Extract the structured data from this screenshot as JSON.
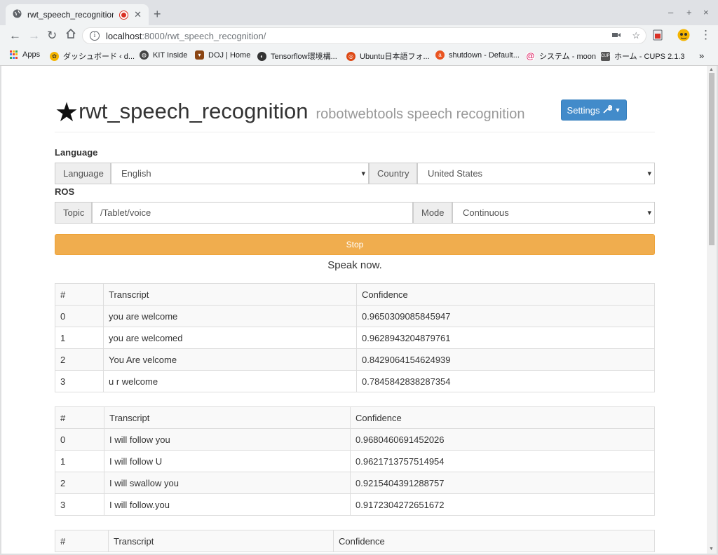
{
  "browser": {
    "tab_title": "rwt_speech_recognition",
    "new_tab_label": "+",
    "url_host": "localhost",
    "url_path": ":8000/rwt_speech_recognition/",
    "window_controls": [
      "–",
      "+",
      "×"
    ],
    "bookmarks": [
      {
        "label": "Apps",
        "icon": "apps-icon"
      },
      {
        "label": "ダッシュボード ‹ d...",
        "icon": "wordpress-icon"
      },
      {
        "label": "KIT Inside",
        "icon": "globe-icon"
      },
      {
        "label": "DOJ | Home",
        "icon": "pin-icon"
      },
      {
        "label": "Tensorflow環境構...",
        "icon": "tensorflow-icon"
      },
      {
        "label": "Ubuntu日本語フォ...",
        "icon": "ubuntu-icon"
      },
      {
        "label": "shutdown - Default...",
        "icon": "askubuntu-icon"
      },
      {
        "label": "システム - moon",
        "icon": "debian-icon"
      },
      {
        "label": "ホーム - CUPS 2.1.3",
        "icon": "cups-icon"
      }
    ],
    "bookmarks_overflow": "»"
  },
  "page": {
    "title": "rwt_speech_recognition",
    "subtitle": "robotwebtools speech recognition",
    "settings_label": "Settings",
    "language_section": "Language",
    "language_addon": "Language",
    "language_value": "English",
    "country_addon": "Country",
    "country_value": "United States",
    "ros_section": "ROS",
    "topic_addon": "Topic",
    "topic_value": "/Tablet/voice",
    "mode_addon": "Mode",
    "mode_value": "Continuous",
    "stop_label": "Stop",
    "status_text": "Speak now.",
    "colors": {
      "primary": "#428bca",
      "warning": "#f0ad4e"
    }
  },
  "tables": [
    {
      "headers": [
        "#",
        "Transcript",
        "Confidence"
      ],
      "rows": [
        [
          "0",
          "you are welcome",
          "0.9650309085845947"
        ],
        [
          "1",
          "you are welcomed",
          "0.9628943204879761"
        ],
        [
          "2",
          "You Are velcome",
          "0.8429064154624939"
        ],
        [
          "3",
          "u r welcome",
          "0.7845842838287354"
        ]
      ]
    },
    {
      "headers": [
        "#",
        "Transcript",
        "Confidence"
      ],
      "rows": [
        [
          "0",
          "I will follow you",
          "0.9680460691452026"
        ],
        [
          "1",
          "I will follow U",
          "0.9621713757514954"
        ],
        [
          "2",
          "I will swallow you",
          "0.9215404391288757"
        ],
        [
          "3",
          "I will follow.you",
          "0.9172304272651672"
        ]
      ]
    },
    {
      "headers": [
        "#",
        "Transcript",
        "Confidence"
      ],
      "rows": []
    }
  ]
}
